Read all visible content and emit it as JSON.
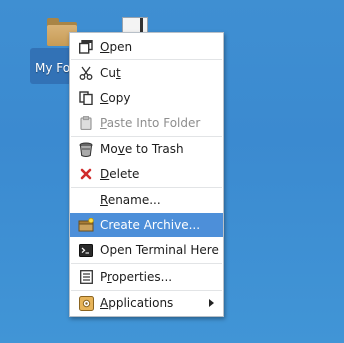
{
  "desktop": {
    "folder_label": "My Fol",
    "folder_icon": "folder-icon",
    "file_icon": "text-file-icon"
  },
  "menu": {
    "items": [
      {
        "label": "Open",
        "mnemonic": "O",
        "icon": "open-window-icon",
        "enabled": true
      },
      {
        "label": "Cut",
        "mnemonic": "t",
        "icon": "scissors-icon",
        "enabled": true
      },
      {
        "label": "Copy",
        "mnemonic": "C",
        "icon": "copy-icon",
        "enabled": true
      },
      {
        "label": "Paste Into Folder",
        "mnemonic": "P",
        "icon": "paste-icon",
        "enabled": false
      },
      {
        "label": "Move to Trash",
        "mnemonic": "v",
        "icon": "trash-icon",
        "enabled": true
      },
      {
        "label": "Delete",
        "mnemonic": "D",
        "icon": "red-x-icon",
        "enabled": true
      },
      {
        "label": "Rename...",
        "mnemonic": "R",
        "icon": "",
        "enabled": true
      },
      {
        "label": "Create Archive...",
        "mnemonic": "",
        "icon": "archive-icon",
        "enabled": true,
        "highlighted": true
      },
      {
        "label": "Open Terminal Here",
        "mnemonic": "",
        "icon": "terminal-icon",
        "enabled": true
      },
      {
        "label": "Properties...",
        "mnemonic": "r",
        "icon": "properties-icon",
        "enabled": true
      },
      {
        "label": "Applications",
        "mnemonic": "A",
        "icon": "applications-icon",
        "enabled": true,
        "submenu": true
      }
    ]
  },
  "colors": {
    "desktop_bg": "#3f8fd2",
    "highlight": "#4d8fd9",
    "delete_red": "#d02b2b"
  }
}
